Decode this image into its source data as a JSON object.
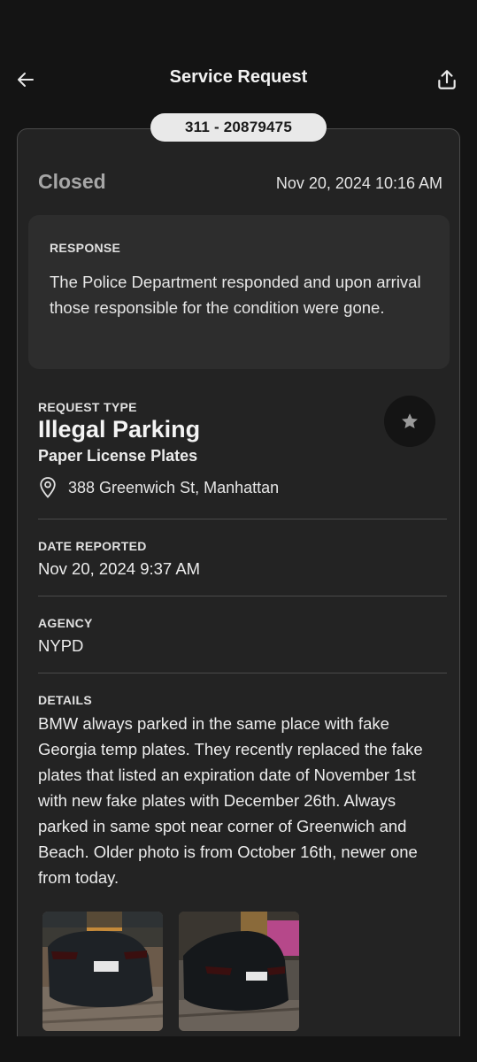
{
  "header": {
    "title": "Service Request",
    "back_icon": "arrow-left-icon",
    "share_icon": "share-icon"
  },
  "request": {
    "id": "311 - 20879475",
    "status": "Closed",
    "status_time": "Nov 20, 2024 10:16 AM"
  },
  "response": {
    "label": "RESPONSE",
    "text": "The Police Department responded and upon arrival those responsible for the condition were gone."
  },
  "request_type": {
    "label": "REQUEST TYPE",
    "title": "Illegal Parking",
    "subtitle": "Paper License Plates",
    "address": "388 Greenwich St, Manhattan",
    "favorite_icon": "star-icon",
    "location_icon": "location-pin-icon"
  },
  "date_reported": {
    "label": "DATE REPORTED",
    "value": "Nov 20, 2024 9:37 AM"
  },
  "agency": {
    "label": "AGENCY",
    "value": "NYPD"
  },
  "details": {
    "label": "DETAILS",
    "text": "BMW always parked in the same place with fake Georgia temp plates. They recently replaced the fake plates that listed an expiration date of November 1st with new fake plates with December 26th. Always parked in same spot near corner of Greenwich and Beach. Older photo is from October 16th, newer one from today."
  },
  "colors": {
    "background": "#141414",
    "card": "#232323",
    "response_box": "#2d2d2d",
    "pill": "#e9e9e9",
    "status_closed": "#a6a6a6"
  }
}
